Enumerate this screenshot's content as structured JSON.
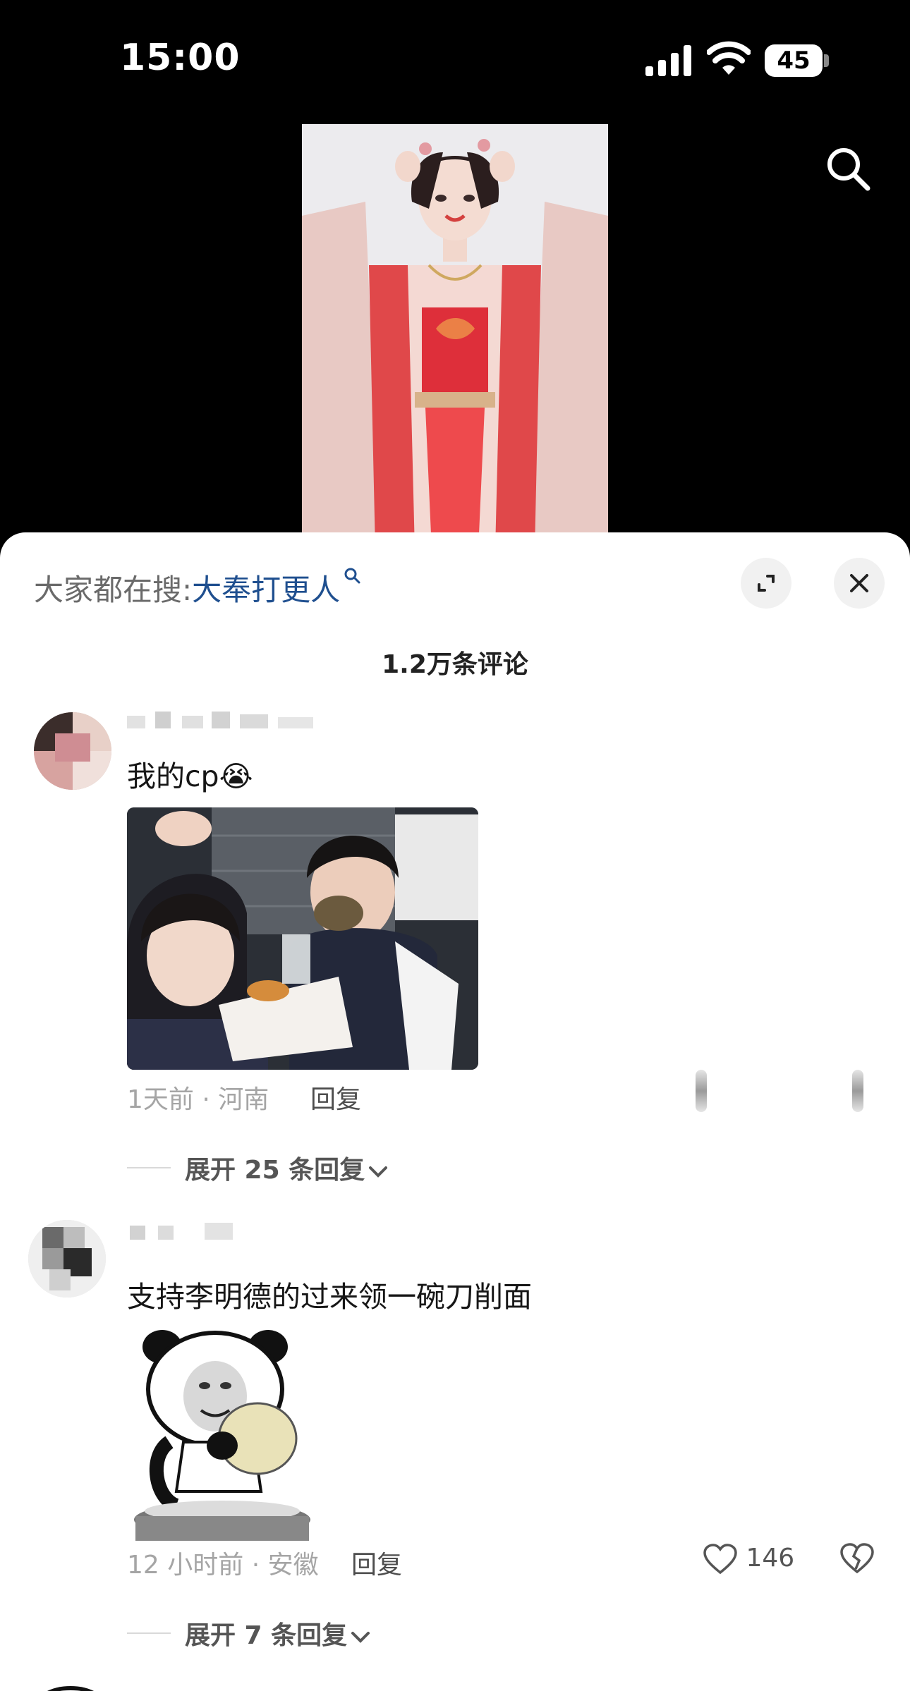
{
  "status_bar": {
    "time": "15:00",
    "battery": "45"
  },
  "sheet": {
    "search_prefix": "大家都在搜:",
    "search_keyword": "大奉打更人",
    "comment_count": "1.2万条评论"
  },
  "comments": [
    {
      "text": "我的cp",
      "emoji": "😭",
      "time_location": "1天前 · 河南",
      "reply_label": "回复",
      "expand_label": "展开 25 条回复"
    },
    {
      "text": "支持李明德的过来领一碗刀削面",
      "time_location": "12 小时前 · 安徽",
      "reply_label": "回复",
      "likes": "146",
      "expand_label": "展开 7 条回复"
    }
  ],
  "colors": {
    "keyword": "#1f4f8f",
    "meta": "#a5a5a5"
  }
}
